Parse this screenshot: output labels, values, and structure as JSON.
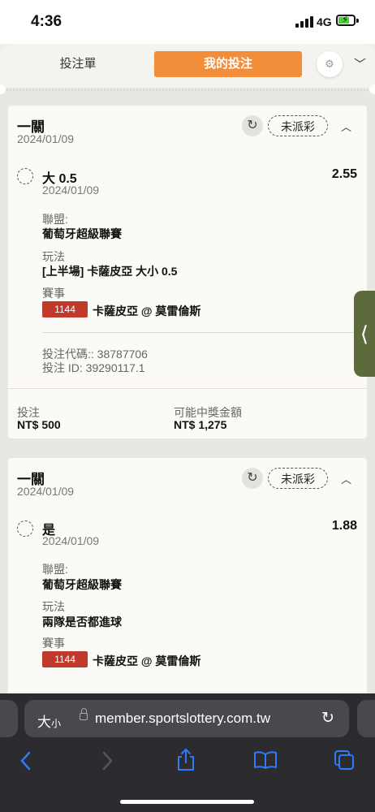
{
  "status": {
    "time": "4:36",
    "network": "4G"
  },
  "tabs": {
    "bet_slip": "投注單",
    "my_bets": "我的投注"
  },
  "bets": [
    {
      "title": "一關",
      "date": "2024/01/09",
      "status": "未派彩",
      "selection": "大 0.5",
      "odds": "2.55",
      "selection_date": "2024/01/09",
      "league_label": "聯盟:",
      "league": "葡萄牙超級聯賽",
      "play_label": "玩法",
      "play": "[上半場] 卡薩皮亞 大小 0.5",
      "event_label": "賽事",
      "event_id": "1144",
      "event": "卡薩皮亞 @ 莫雷倫斯",
      "bet_code": "投注代碼:: 38787706",
      "bet_id": "投注 ID: 39290117.1",
      "stake_label": "投注",
      "stake": "NT$ 500",
      "payout_label": "可能中獎金額",
      "payout": "NT$ 1,275"
    },
    {
      "title": "一關",
      "date": "2024/01/09",
      "status": "未派彩",
      "selection": "是",
      "odds": "1.88",
      "selection_date": "2024/01/09",
      "league_label": "聯盟:",
      "league": "葡萄牙超級聯賽",
      "play_label": "玩法",
      "play": "兩隊是否都進球",
      "event_label": "賽事",
      "event_id": "1144",
      "event": "卡薩皮亞 @ 莫雷倫斯"
    }
  ],
  "browser": {
    "text_size": "大",
    "text_size_small": "小",
    "url": "member.sportslottery.com.tw"
  },
  "icons": [
    "signal-icon",
    "battery-icon",
    "gear-icon",
    "chevron-down-icon",
    "refresh-icon",
    "chevron-up-icon",
    "spinner-icon",
    "side-arrow-icon",
    "lock-icon",
    "reload-icon",
    "back-icon",
    "forward-icon",
    "share-icon",
    "bookmarks-icon",
    "tabs-icon"
  ],
  "colors": {
    "accent": "#f28d3a",
    "badge": "#c0392b",
    "side_tab": "#5d6a3c",
    "link": "#2f7bf6"
  }
}
